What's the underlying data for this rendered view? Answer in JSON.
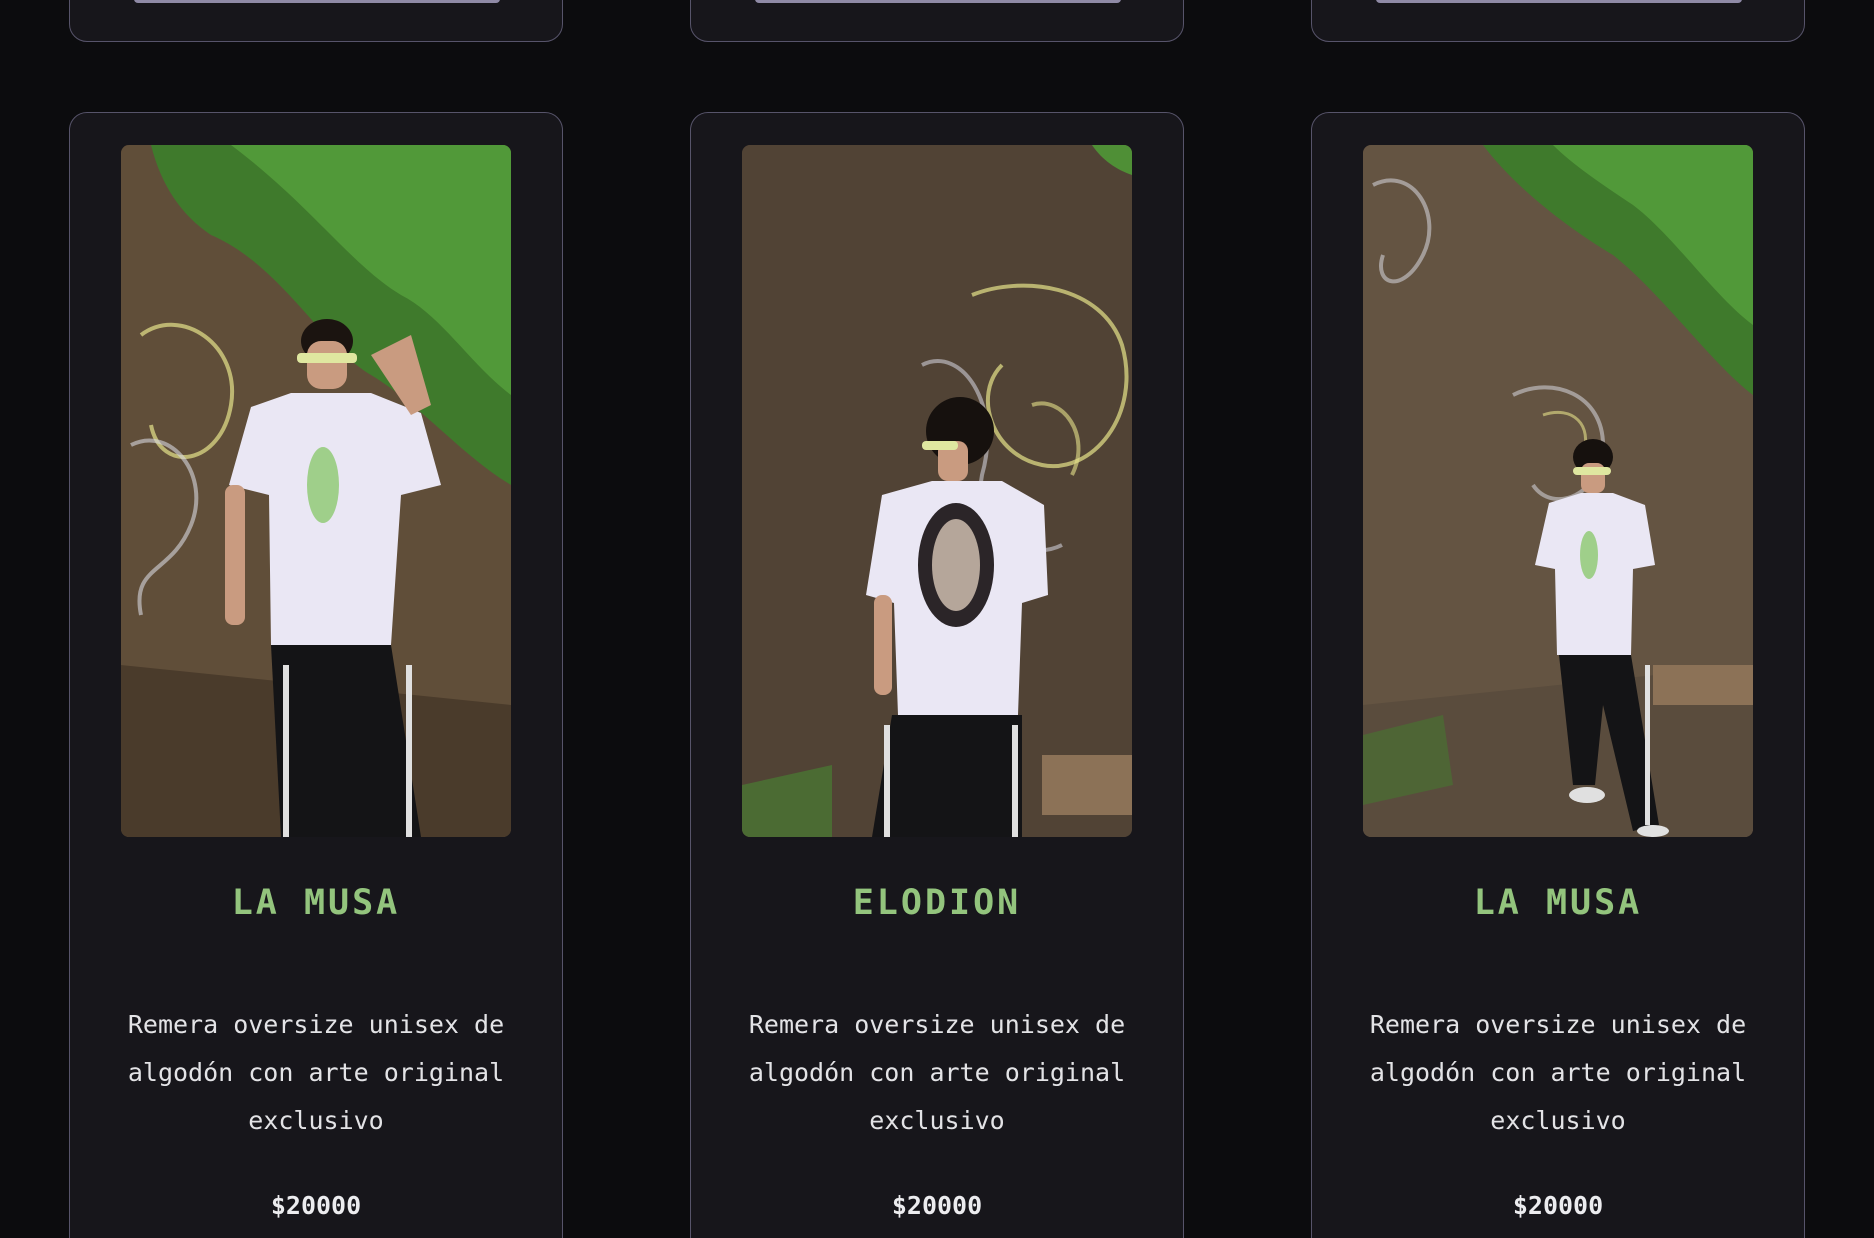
{
  "colors": {
    "page_background": "#0c0c0e",
    "card_background": "#17161b",
    "card_border": "#57546a",
    "title_accent": "#93c47d",
    "text": "#e3e3e6"
  },
  "products": [
    {
      "name": "LA MUSA",
      "description": "Remera oversize unisex de algodón con arte original exclusivo",
      "price": "$20000",
      "image_icon": "product-photo-front-icon"
    },
    {
      "name": "ELODION",
      "description": "Remera oversize unisex de algodón con arte original exclusivo",
      "price": "$20000",
      "image_icon": "product-photo-back-icon"
    },
    {
      "name": "LA MUSA",
      "description": "Remera oversize unisex de algodón con arte original exclusivo",
      "price": "$20000",
      "image_icon": "product-photo-full-icon"
    }
  ]
}
